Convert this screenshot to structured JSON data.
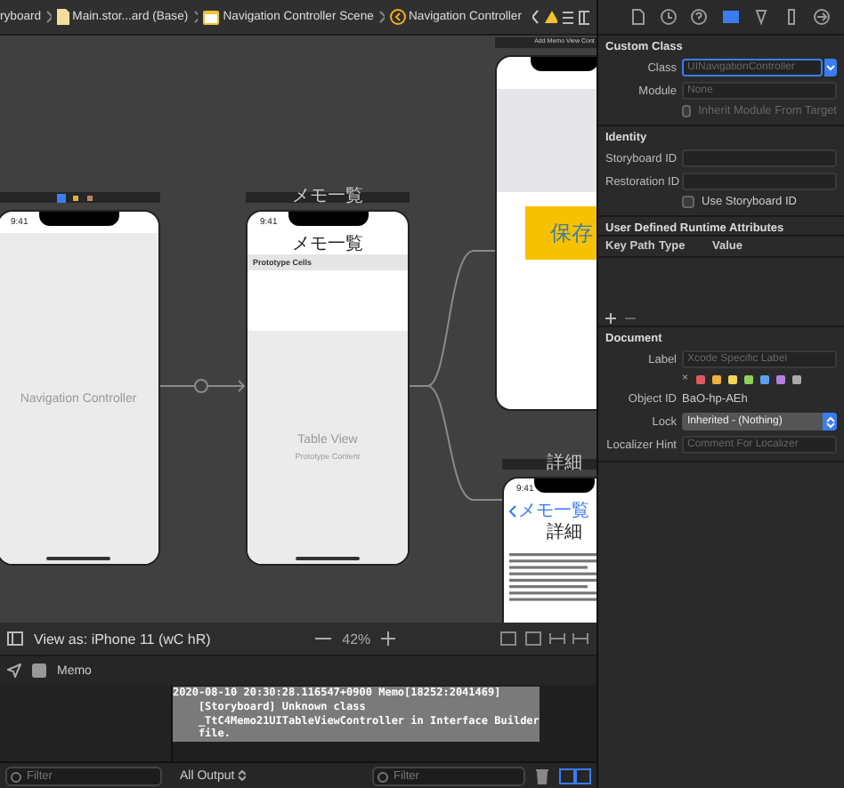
{
  "breadcrumb": [
    {
      "label": "ryboard"
    },
    {
      "label": "Main.stor...ard (Base)"
    },
    {
      "label": "Navigation Controller Scene"
    },
    {
      "label": "Navigation Controller"
    }
  ],
  "canvas": {
    "scenes": [
      {
        "kind": "navigation",
        "time": "9:41",
        "label": "Navigation Controller"
      },
      {
        "kind": "table",
        "header": "メモ一覧",
        "time": "9:41",
        "nav_title": "メモ一覧",
        "section": "Prototype Cells",
        "label": "Table View",
        "sublabel": "Prototype Content"
      },
      {
        "kind": "add",
        "header": "Add Memo View Cont",
        "button": "保存"
      },
      {
        "kind": "detail",
        "header": "詳細",
        "time": "9:41",
        "back": "メモ一覧",
        "nav_title": "詳細"
      }
    ]
  },
  "canvas_toolbar": {
    "view_as": "View as: iPhone 11 (wC hR)",
    "zoom": "42%"
  },
  "debug_bar": {
    "target": "Memo"
  },
  "console": {
    "output": "2020-08-10 20:30:28.116547+0900 Memo[18252:2041469]\n    [Storyboard] Unknown class\n    _TtC4Memo21UITableViewController in Interface Builder\n    file.",
    "left_filter": {
      "placeholder": "Filter"
    },
    "output_menu": "All Output",
    "right_filter": {
      "placeholder": "Filter"
    }
  },
  "inspector": {
    "tabs": [
      {
        "selected": false
      },
      {
        "selected": false
      },
      {
        "selected": false
      },
      {
        "selected": true
      },
      {
        "selected": false
      },
      {
        "selected": false
      },
      {
        "selected": false
      }
    ],
    "custom_class": {
      "title": "Custom Class",
      "class_label": "Class",
      "class_placeholder": "UINavigationController",
      "module_label": "Module",
      "module_placeholder": "None",
      "inherit_label": "Inherit Module From Target",
      "inherit_checked": false
    },
    "identity": {
      "title": "Identity",
      "storyboard_id_label": "Storyboard ID",
      "restoration_id_label": "Restoration ID",
      "use_storyboard_id_label": "Use Storyboard ID",
      "use_storyboard_id_checked": false
    },
    "runtime_attributes": {
      "title": "User Defined Runtime Attributes",
      "columns": [
        "Key Path",
        "Type",
        "Value"
      ]
    },
    "document": {
      "title": "Document",
      "label_label": "Label",
      "label_placeholder": "Xcode Specific Label",
      "none_mark": "×",
      "colors": [
        {
          "color": "#e05a5f"
        },
        {
          "color": "#f0b23c"
        },
        {
          "color": "#f2d65a"
        },
        {
          "color": "#8cd25c"
        },
        {
          "color": "#5f9ff0"
        },
        {
          "color": "#b680e0"
        },
        {
          "color": "#a8a8a8"
        }
      ],
      "object_id_label": "Object ID",
      "object_id": "BaO-hp-AEh",
      "lock_label": "Lock",
      "lock_value": "Inherited - (Nothing)",
      "localizer_label": "Localizer Hint",
      "localizer_placeholder": "Comment For Localizer"
    }
  }
}
